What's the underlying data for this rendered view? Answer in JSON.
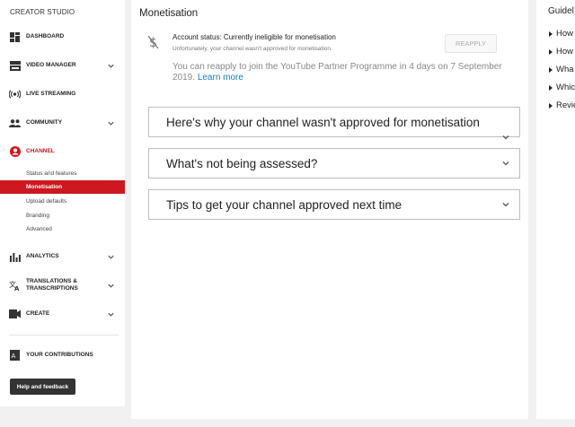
{
  "sidebar": {
    "title": "CREATOR STUDIO",
    "items": [
      {
        "label": "DASHBOARD",
        "icon": "dashboard-icon"
      },
      {
        "label": "VIDEO MANAGER",
        "icon": "video-manager-icon"
      },
      {
        "label": "LIVE STREAMING",
        "icon": "live-streaming-icon"
      },
      {
        "label": "COMMUNITY",
        "icon": "community-icon"
      },
      {
        "label": "CHANNEL",
        "icon": "channel-icon"
      },
      {
        "label": "ANALYTICS",
        "icon": "analytics-icon"
      },
      {
        "label": "TRANSLATIONS & TRANSCRIPTIONS",
        "icon": "translations-icon"
      },
      {
        "label": "CREATE",
        "icon": "create-icon"
      },
      {
        "label": "YOUR CONTRIBUTIONS",
        "icon": "contributions-icon"
      }
    ],
    "channel_sub": [
      "Status and features",
      "Monetisation",
      "Upload defaults",
      "Branding",
      "Advanced"
    ],
    "help_label": "Help and feedback",
    "accent_color": "#cc181e"
  },
  "main": {
    "title": "Monetisation",
    "status_heading": "Account status: Currently ineligible for monetisation",
    "status_sub": "Unfortunately, your channel wasn't approved for monetisation.",
    "reapply_label": "REAPPLY",
    "reapply_note": "You can reapply to join the YouTube Partner Programme in 4 days on 7 September 2019.",
    "learn_more": "Learn more",
    "link_color": "#167ac6",
    "accordions": [
      {
        "title": "Here's why your channel wasn't approved for monetisation"
      },
      {
        "title": "What's not being assessed?"
      },
      {
        "title": "Tips to get your channel approved next time"
      }
    ]
  },
  "right": {
    "title": "Guidel",
    "items": [
      "How",
      "How",
      "Wha",
      "Whic",
      "Revie"
    ]
  }
}
